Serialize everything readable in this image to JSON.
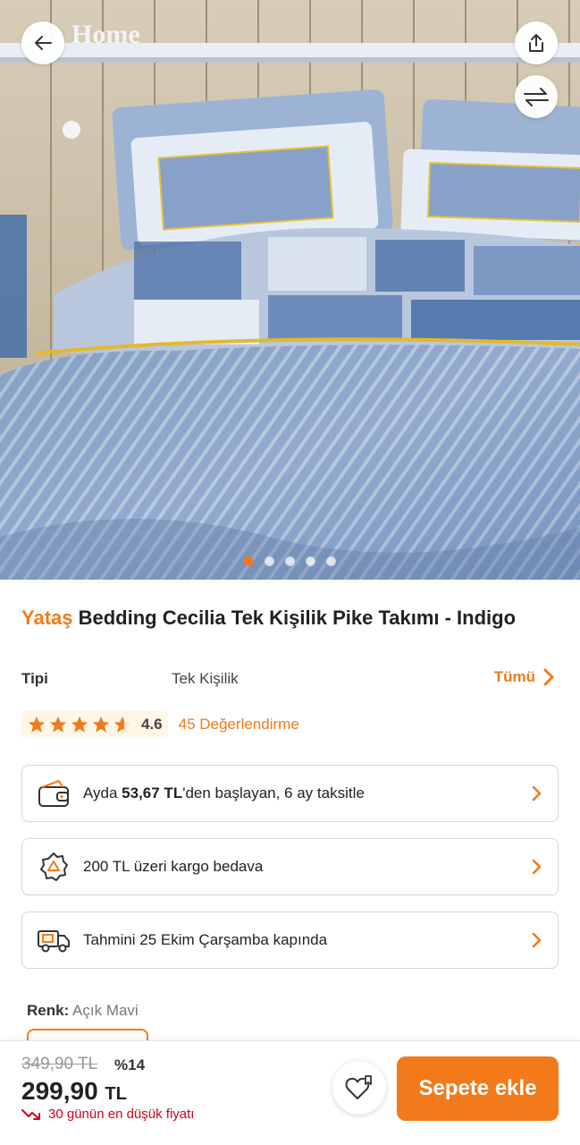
{
  "gallery": {
    "wall_sign": "Home",
    "dot_count": 5,
    "active_index": 0,
    "back_icon": "arrow-left-icon",
    "share_icon": "share-icon",
    "compare_icon": "compare-arrows-icon"
  },
  "product": {
    "brand": "Yataş",
    "name": "Bedding Cecilia Tek Kişilik Pike Takımı - Indigo"
  },
  "type": {
    "label": "Tipi",
    "value": "Tek Kişilik",
    "all_label": "Tümü"
  },
  "rating": {
    "value": "4.6",
    "count_label": "45 Değerlendirme",
    "stars_filled": 4.6
  },
  "info_cards": {
    "installment": {
      "prefix": "Ayda ",
      "amount": "53,67 TL",
      "suffix": "'den başlayan, 6 ay taksitle",
      "icon": "wallet-icon"
    },
    "shipping": {
      "text": "200 TL üzeri kargo bedava",
      "icon": "free-shipping-icon"
    },
    "delivery": {
      "text": "Tahmini 25 Ekim Çarşamba kapında",
      "icon": "delivery-truck-icon"
    }
  },
  "color": {
    "label": "Renk:",
    "value": "Açık Mavi"
  },
  "bottom_bar": {
    "old_price": "349,90 TL",
    "discount": "%14",
    "price": "299,90",
    "currency": "TL",
    "lowest_note": "30 günün en düşük fiyatı",
    "cart_label": "Sepete ekle"
  },
  "colors": {
    "accent": "#f27a1a",
    "price_down": "#d0021b",
    "star": "#f27a1a"
  }
}
